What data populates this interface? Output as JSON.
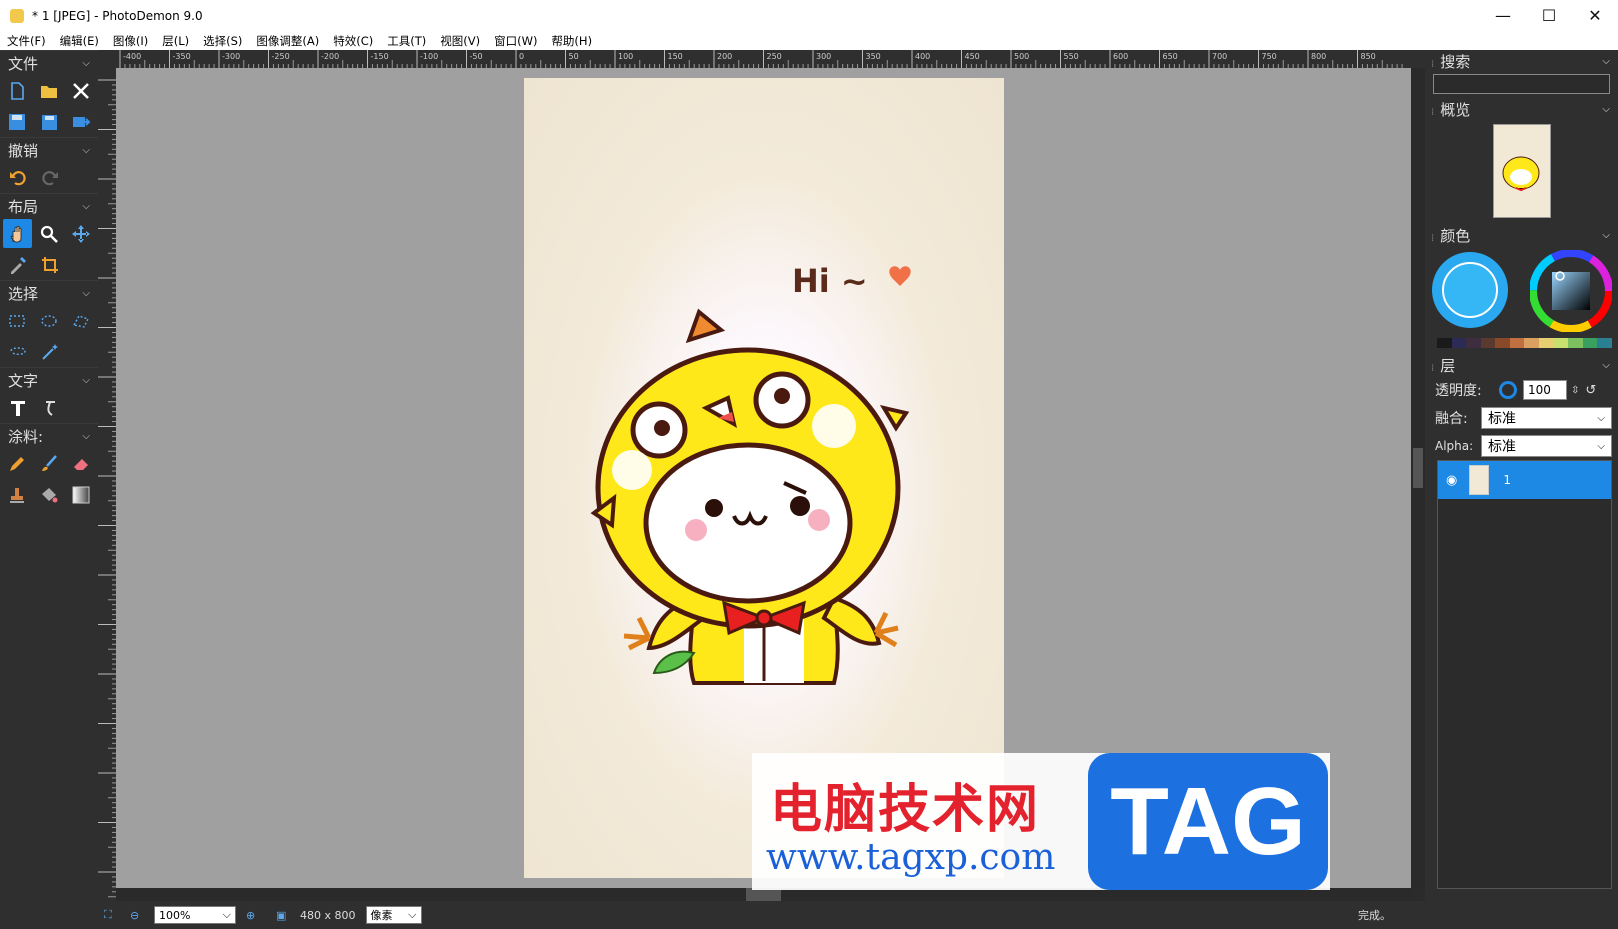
{
  "window": {
    "title": "* 1 [JPEG]  -  PhotoDemon 9.0",
    "minimize": "—",
    "maximize": "☐",
    "close": "✕"
  },
  "menu": [
    "文件(F)",
    "编辑(E)",
    "图像(I)",
    "层(L)",
    "选择(S)",
    "图像调整(A)",
    "特效(C)",
    "工具(T)",
    "视图(V)",
    "窗口(W)",
    "帮助(H)"
  ],
  "toolbox": {
    "file": "文件",
    "undo": "撤销",
    "layout": "布局",
    "select": "选择",
    "text": "文字",
    "paint": "涂料:"
  },
  "ruler_labels": [
    "-400",
    "-350",
    "-300",
    "-250",
    "-200",
    "-150",
    "-100",
    "-50",
    "0",
    "50",
    "100",
    "150",
    "200",
    "250",
    "300",
    "350",
    "400",
    "450",
    "500",
    "550",
    "600",
    "650",
    "700",
    "750",
    "800",
    "850"
  ],
  "status": {
    "zoom": "100%",
    "size": "480 x 800",
    "unit": "像素",
    "done": "完成。"
  },
  "panels": {
    "search": "搜索",
    "overview": "概览",
    "color": "颜色",
    "layers": "层",
    "opacity_label": "透明度:",
    "opacity_value": "100",
    "blend_label": "融合:",
    "blend_value": "标准",
    "alpha_label": "Alpha:",
    "alpha_value": "标准",
    "layer_name": "1"
  },
  "image_text": {
    "greeting": "Hi ~"
  },
  "watermark": {
    "cn": "电脑技术网",
    "url": "www.tagxp.com",
    "tag": "TAG"
  },
  "palette_colors": [
    "#1a1a1a",
    "#2b2b55",
    "#3e2d3e",
    "#5a3a2e",
    "#8a4a2a",
    "#c07040",
    "#d9a060",
    "#e8d070",
    "#c8e070",
    "#7cc060",
    "#3aa060",
    "#2a8090"
  ],
  "accent": "#1e88e5"
}
